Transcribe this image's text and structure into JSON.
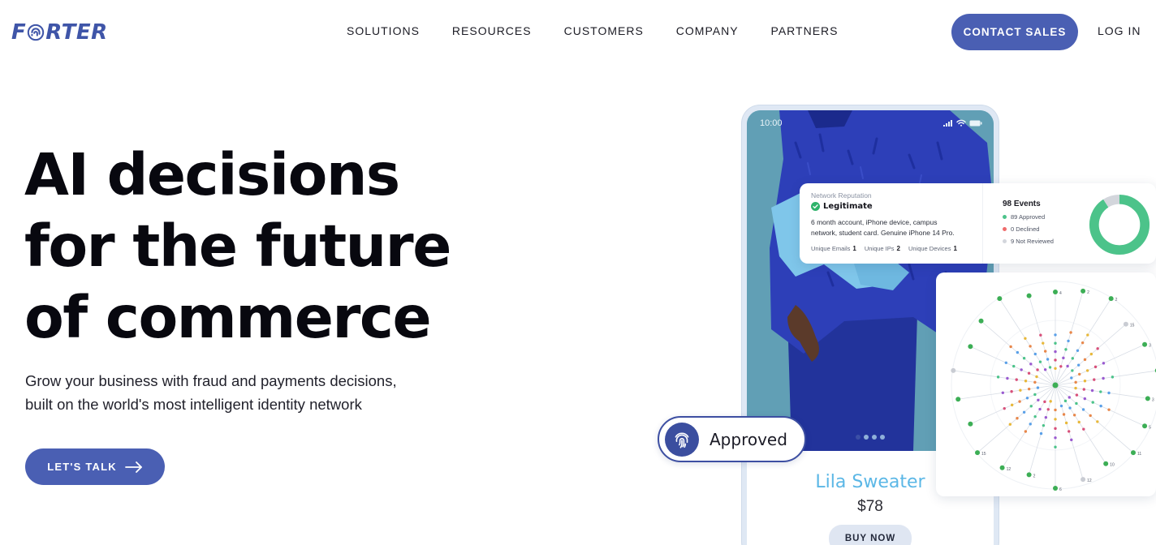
{
  "brand": {
    "logo_text": "FORTER",
    "logo_before": "F",
    "logo_after": "RTER",
    "accent": "#4a5fb3"
  },
  "nav": {
    "items": [
      {
        "label": "SOLUTIONS"
      },
      {
        "label": "RESOURCES"
      },
      {
        "label": "CUSTOMERS"
      },
      {
        "label": "COMPANY"
      },
      {
        "label": "PARTNERS"
      }
    ],
    "contact_label": "CONTACT SALES",
    "login_label": "LOG IN"
  },
  "hero": {
    "title_lines": [
      "AI decisions",
      "for the future",
      "of commerce"
    ],
    "subtitle_lines": [
      "Grow your business with fraud and payments decisions,",
      "built on the world's most intelligent identity network"
    ],
    "cta_label": "LET'S TALK",
    "cta_icon": "arrow-right-icon"
  },
  "phone": {
    "time": "10:00",
    "status_icons": [
      "signal-icon",
      "wifi-icon",
      "battery-icon"
    ],
    "carousel_dots": 4,
    "active_dot": 0,
    "product_name": "Lila Sweater",
    "product_price": "$78",
    "buy_label": "BUY NOW"
  },
  "network_card": {
    "label": "Network Reputation",
    "status": "Legitimate",
    "status_color": "#2fb36b",
    "description_lines": [
      "6 month account, iPhone device, campus",
      "network, student card. Genuine iPhone 14 Pro."
    ],
    "stats": [
      {
        "label": "Unique Emails",
        "value": "1"
      },
      {
        "label": "Unique IPs",
        "value": "2"
      },
      {
        "label": "Unique Devices",
        "value": "1"
      }
    ],
    "events_title": "98 Events",
    "events": [
      {
        "label": "89 Approved",
        "value": 89,
        "color": "#4cc38a"
      },
      {
        "label": "0 Declined",
        "value": 0,
        "color": "#ef6b6b"
      },
      {
        "label": "9 Not Reviewed",
        "value": 9,
        "color": "#d3d6dc"
      }
    ]
  },
  "graph_card": {
    "node_labels": [
      "4",
      "2",
      "2",
      "15",
      "3",
      "2",
      "3",
      "5",
      "11",
      "10",
      "12",
      "6",
      "2",
      "12",
      "15"
    ]
  },
  "approved_badge": {
    "label": "Approved",
    "icon": "fingerprint-icon"
  }
}
